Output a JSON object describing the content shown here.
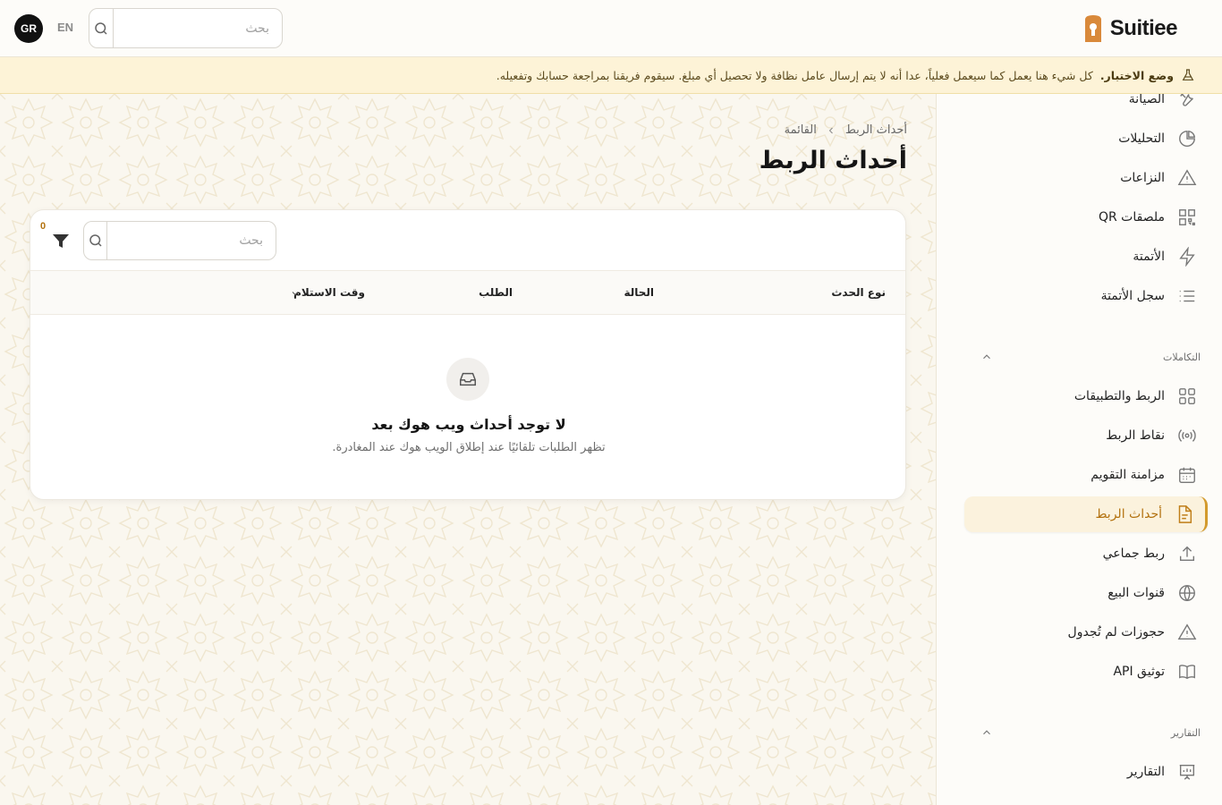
{
  "header": {
    "brand": "Suitiee",
    "avatar_initials": "GR",
    "language_label": "EN",
    "search_placeholder": "بحث"
  },
  "banner": {
    "title": "وضع الاختبار.",
    "message": "كل شيء هنا يعمل كما سيعمل فعلياً، عدا أنه لا يتم إرسال عامل نظافة ولا تحصيل أي مبلغ. سيقوم فريقنا بمراجعة حسابك وتفعيله."
  },
  "sidebar": {
    "items_top": [
      {
        "label": "الصيانة",
        "icon": "wrench-icon"
      },
      {
        "label": "التحليلات",
        "icon": "pie-chart-icon"
      },
      {
        "label": "النزاعات",
        "icon": "warning-icon"
      },
      {
        "label": "ملصقات QR",
        "icon": "qr-code-icon"
      },
      {
        "label": "الأتمتة",
        "icon": "lightning-icon"
      },
      {
        "label": "سجل الأتمتة",
        "icon": "list-icon"
      }
    ],
    "section_integrations": "التكاملات",
    "items_integrations": [
      {
        "label": "الربط والتطبيقات",
        "icon": "grid-icon"
      },
      {
        "label": "نقاط الربط",
        "icon": "broadcast-icon"
      },
      {
        "label": "مزامنة التقويم",
        "icon": "calendar-icon"
      },
      {
        "label": "أحداث الربط",
        "icon": "document-icon",
        "active": true
      },
      {
        "label": "ربط جماعي",
        "icon": "upload-icon"
      },
      {
        "label": "قنوات البيع",
        "icon": "globe-icon"
      },
      {
        "label": "حجوزات لم تُجدول",
        "icon": "warning-icon"
      },
      {
        "label": "توثيق API",
        "icon": "book-icon"
      }
    ],
    "section_reports": "التقارير",
    "items_reports": [
      {
        "label": "التقارير",
        "icon": "presentation-chart-icon"
      }
    ]
  },
  "main": {
    "breadcrumb": [
      "أحداث الربط",
      "القائمة"
    ],
    "title": "أحداث الربط",
    "search_placeholder": "بحث",
    "filter_count": "0",
    "columns": [
      "نوع الحدث",
      "الحالة",
      "الطلب",
      "وقت الاستلام"
    ],
    "empty_title": "لا توجد أحداث ويب هوك بعد",
    "empty_subtitle": "تظهر الطلبات تلقائيًا عند إطلاق الويب هوك عند المغادرة."
  },
  "colors": {
    "accent": "#d39a2c",
    "accent_text": "#b3720f",
    "banner_bg": "#fdf3d7",
    "page_bg": "#faf7ef"
  }
}
